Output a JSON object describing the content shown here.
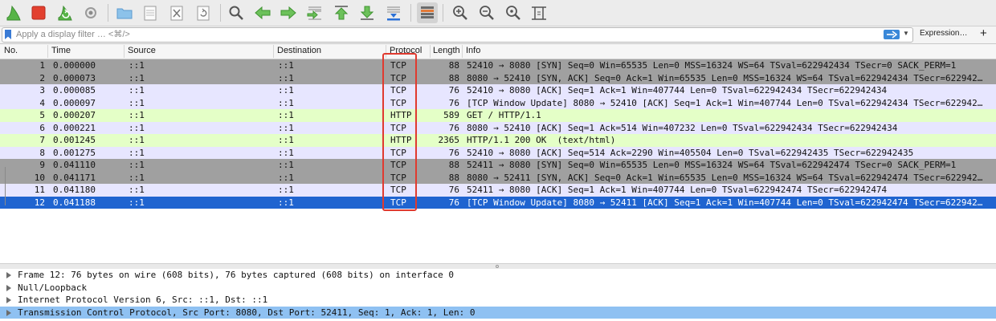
{
  "toolbar": {
    "buttons": [
      {
        "icon": "shark-fin-start-icon"
      },
      {
        "icon": "stop-capture-icon"
      },
      {
        "icon": "restart-capture-icon"
      },
      {
        "icon": "capture-options-gear-icon"
      },
      {
        "icon": "open-folder-icon"
      },
      {
        "icon": "save-file-icon"
      },
      {
        "icon": "close-file-icon"
      },
      {
        "icon": "reload-file-icon"
      },
      {
        "icon": "find-packet-icon"
      },
      {
        "icon": "go-back-icon"
      },
      {
        "icon": "go-forward-icon"
      },
      {
        "icon": "go-to-packet-icon"
      },
      {
        "icon": "go-first-packet-icon"
      },
      {
        "icon": "go-last-packet-icon"
      },
      {
        "icon": "autoscroll-icon"
      },
      {
        "icon": "colorize-icon"
      },
      {
        "icon": "zoom-in-icon"
      },
      {
        "icon": "zoom-out-icon"
      },
      {
        "icon": "normal-size-icon"
      },
      {
        "icon": "resize-columns-icon"
      }
    ]
  },
  "filter": {
    "placeholder": "Apply a display filter … <⌘/>",
    "expression_label": "Expression…",
    "plus_label": "+"
  },
  "columns": {
    "no": "No.",
    "time": "Time",
    "source": "Source",
    "destination": "Destination",
    "protocol": "Protocol",
    "length": "Length",
    "info": "Info"
  },
  "packets": [
    {
      "no": "1",
      "time": "0.000000",
      "source": "::1",
      "destination": "::1",
      "protocol": "TCP",
      "length": "88",
      "info": "52410 → 8080 [SYN] Seq=0 Win=65535 Len=0 MSS=16324 WS=64 TSval=622942434 TSecr=0 SACK_PERM=1"
    },
    {
      "no": "2",
      "time": "0.000073",
      "source": "::1",
      "destination": "::1",
      "protocol": "TCP",
      "length": "88",
      "info": "8080 → 52410 [SYN, ACK] Seq=0 Ack=1 Win=65535 Len=0 MSS=16324 WS=64 TSval=622942434 TSecr=622942…"
    },
    {
      "no": "3",
      "time": "0.000085",
      "source": "::1",
      "destination": "::1",
      "protocol": "TCP",
      "length": "76",
      "info": "52410 → 8080 [ACK] Seq=1 Ack=1 Win=407744 Len=0 TSval=622942434 TSecr=622942434"
    },
    {
      "no": "4",
      "time": "0.000097",
      "source": "::1",
      "destination": "::1",
      "protocol": "TCP",
      "length": "76",
      "info": "[TCP Window Update] 8080 → 52410 [ACK] Seq=1 Ack=1 Win=407744 Len=0 TSval=622942434 TSecr=622942…"
    },
    {
      "no": "5",
      "time": "0.000207",
      "source": "::1",
      "destination": "::1",
      "protocol": "HTTP",
      "length": "589",
      "info": "GET / HTTP/1.1"
    },
    {
      "no": "6",
      "time": "0.000221",
      "source": "::1",
      "destination": "::1",
      "protocol": "TCP",
      "length": "76",
      "info": "8080 → 52410 [ACK] Seq=1 Ack=514 Win=407232 Len=0 TSval=622942434 TSecr=622942434"
    },
    {
      "no": "7",
      "time": "0.001245",
      "source": "::1",
      "destination": "::1",
      "protocol": "HTTP",
      "length": "2365",
      "info": "HTTP/1.1 200 OK  (text/html)"
    },
    {
      "no": "8",
      "time": "0.001275",
      "source": "::1",
      "destination": "::1",
      "protocol": "TCP",
      "length": "76",
      "info": "52410 → 8080 [ACK] Seq=514 Ack=2290 Win=405504 Len=0 TSval=622942435 TSecr=622942435"
    },
    {
      "no": "9",
      "time": "0.041110",
      "source": "::1",
      "destination": "::1",
      "protocol": "TCP",
      "length": "88",
      "info": "52411 → 8080 [SYN] Seq=0 Win=65535 Len=0 MSS=16324 WS=64 TSval=622942474 TSecr=0 SACK_PERM=1"
    },
    {
      "no": "10",
      "time": "0.041171",
      "source": "::1",
      "destination": "::1",
      "protocol": "TCP",
      "length": "88",
      "info": "8080 → 52411 [SYN, ACK] Seq=0 Ack=1 Win=65535 Len=0 MSS=16324 WS=64 TSval=622942474 TSecr=622942…"
    },
    {
      "no": "11",
      "time": "0.041180",
      "source": "::1",
      "destination": "::1",
      "protocol": "TCP",
      "length": "76",
      "info": "52411 → 8080 [ACK] Seq=1 Ack=1 Win=407744 Len=0 TSval=622942474 TSecr=622942474"
    },
    {
      "no": "12",
      "time": "0.041188",
      "source": "::1",
      "destination": "::1",
      "protocol": "TCP",
      "length": "76",
      "info": "[TCP Window Update] 8080 → 52411 [ACK] Seq=1 Ack=1 Win=407744 Len=0 TSval=622942474 TSecr=622942…"
    }
  ],
  "details": [
    "Frame 12: 76 bytes on wire (608 bits), 76 bytes captured (608 bits) on interface 0",
    "Null/Loopback",
    "Internet Protocol Version 6, Src: ::1, Dst: ::1",
    "Transmission Control Protocol, Src Port: 8080, Dst Port: 52411, Seq: 1, Ack: 1, Len: 0"
  ],
  "colors": {
    "selected_row": "#1f64d0",
    "tcp_row": "#e7e6ff",
    "http_row": "#e4ffc7",
    "syn_row": "#a0a0a0",
    "highlight_box": "#e03a2f"
  }
}
